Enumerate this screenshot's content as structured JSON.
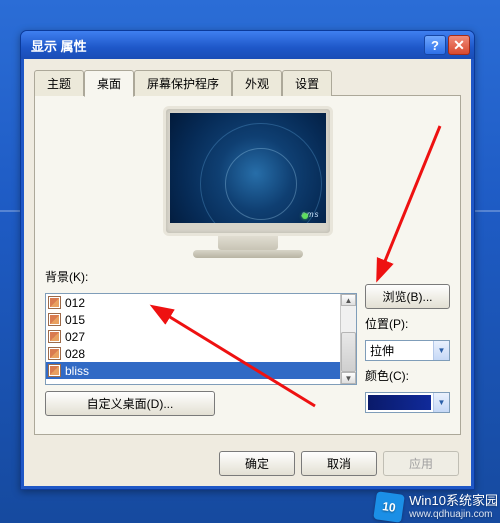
{
  "dialog": {
    "title": "显示 属性",
    "help_label": "?",
    "close_label": "✕"
  },
  "tabs": {
    "theme": "主题",
    "desktop": "桌面",
    "screensaver": "屏幕保护程序",
    "appearance": "外观",
    "settings": "设置"
  },
  "preview": {
    "brand": "ams"
  },
  "background": {
    "label": "背景(K):",
    "items": [
      "012",
      "015",
      "027",
      "028",
      "bliss"
    ],
    "selected_index": 4
  },
  "browse": {
    "label": "浏览(B)..."
  },
  "position": {
    "label": "位置(P):",
    "value": "拉伸"
  },
  "color": {
    "label": "颜色(C):"
  },
  "custom_desktop": {
    "label": "自定义桌面(D)..."
  },
  "buttons": {
    "ok": "确定",
    "cancel": "取消",
    "apply": "应用"
  },
  "scroll": {
    "up": "▲",
    "down": "▼"
  },
  "combo_arrow": "▼",
  "watermark": {
    "logo": "10",
    "line1": "Win10系统家园",
    "line2": "www.qdhuajin.com"
  }
}
